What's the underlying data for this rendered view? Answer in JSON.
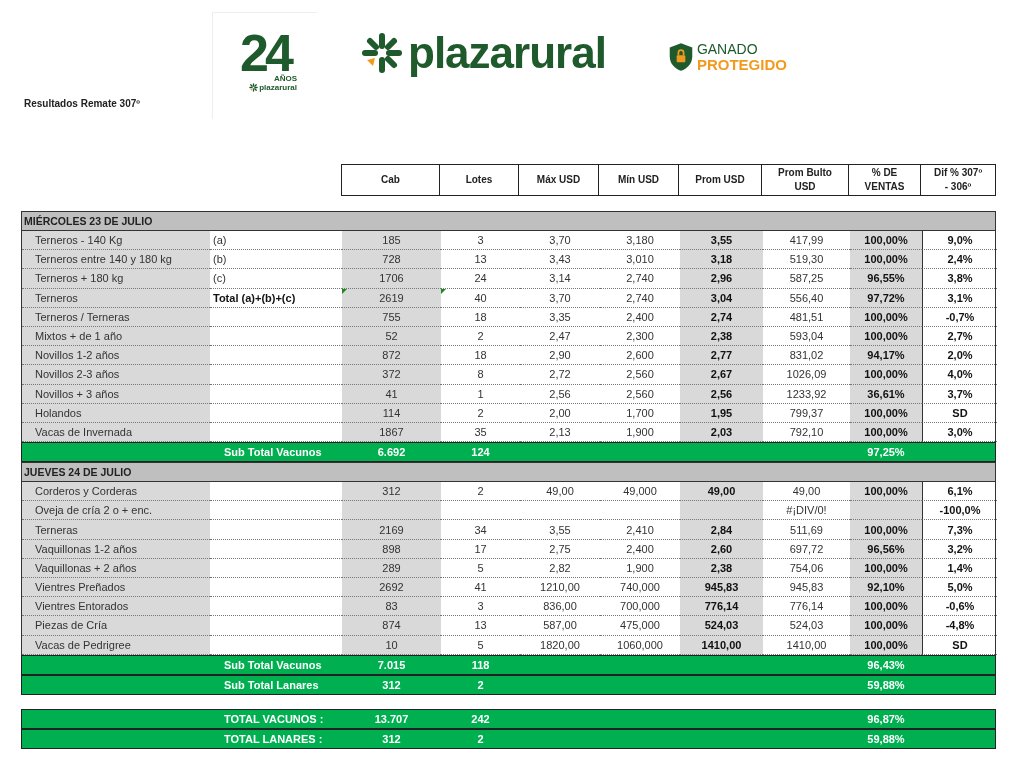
{
  "page_title": "Resultados Remate 307º",
  "anniversary_logo": {
    "number": "24",
    "label": "AÑOS",
    "brand": "plazarural"
  },
  "brand_logo": {
    "name": "plazarural"
  },
  "badge_logo": {
    "line_1": "GANADO",
    "line_2": "PROTEGIDO"
  },
  "columns": [
    "Cab",
    "Lotes",
    "Máx USD",
    "Mín USD",
    "Prom USD",
    "Prom Bulto USD",
    "% DE VENTAS",
    "Dif % 307º - 306º"
  ],
  "sections": [
    {
      "title": "MIÉRCOLES 23 DE JULIO",
      "rows": [
        {
          "kind": "item",
          "name": "Terneros - 140 Kg",
          "note": "(a)",
          "cab": "185",
          "lotes": "3",
          "max": "3,70",
          "min": "3,180",
          "prom": "3,55",
          "bulto": "417,99",
          "pct": "100,00%",
          "dif": "9,0%"
        },
        {
          "kind": "item",
          "name": "Terneros entre 140 y 180 kg",
          "note": "(b)",
          "cab": "728",
          "lotes": "13",
          "max": "3,43",
          "min": "3,010",
          "prom": "3,18",
          "bulto": "519,30",
          "pct": "100,00%",
          "dif": "2,4%"
        },
        {
          "kind": "item",
          "name": "Terneros + 180 kg",
          "note": "(c)",
          "cab": "1706",
          "lotes": "24",
          "max": "3,14",
          "min": "2,740",
          "prom": "2,96",
          "bulto": "587,25",
          "pct": "96,55%",
          "dif": "3,8%"
        },
        {
          "kind": "total",
          "name": "Terneros",
          "note": "Total (a)+(b)+(c)",
          "cab": "2619",
          "lotes": "40",
          "max": "3,70",
          "min": "2,740",
          "prom": "3,04",
          "bulto": "556,40",
          "pct": "97,72%",
          "dif": "3,1%"
        },
        {
          "kind": "item",
          "name": "Terneros / Terneras",
          "cab": "755",
          "lotes": "18",
          "max": "3,35",
          "min": "2,400",
          "prom": "2,74",
          "bulto": "481,51",
          "pct": "100,00%",
          "dif": "-0,7%"
        },
        {
          "kind": "item",
          "name": "Mixtos + de 1 año",
          "cab": "52",
          "lotes": "2",
          "max": "2,47",
          "min": "2,300",
          "prom": "2,38",
          "bulto": "593,04",
          "pct": "100,00%",
          "dif": "2,7%"
        },
        {
          "kind": "item",
          "name": "Novillos 1-2 años",
          "cab": "872",
          "lotes": "18",
          "max": "2,90",
          "min": "2,600",
          "prom": "2,77",
          "bulto": "831,02",
          "pct": "94,17%",
          "dif": "2,0%"
        },
        {
          "kind": "item",
          "name": "Novillos 2-3 años",
          "cab": "372",
          "lotes": "8",
          "max": "2,72",
          "min": "2,560",
          "prom": "2,67",
          "bulto": "1026,09",
          "pct": "100,00%",
          "dif": "4,0%"
        },
        {
          "kind": "item",
          "name": "Novillos + 3 años",
          "cab": "41",
          "lotes": "1",
          "max": "2,56",
          "min": "2,560",
          "prom": "2,56",
          "bulto": "1233,92",
          "pct": "36,61%",
          "dif": "3,7%"
        },
        {
          "kind": "item",
          "name": "Holandos",
          "cab": "114",
          "lotes": "2",
          "max": "2,00",
          "min": "1,700",
          "prom": "1,95",
          "bulto": "799,37",
          "pct": "100,00%",
          "dif": "SD"
        },
        {
          "kind": "item",
          "name": "Vacas de Invernada",
          "cab": "1867",
          "lotes": "35",
          "max": "2,13",
          "min": "1,900",
          "prom": "2,03",
          "bulto": "792,10",
          "pct": "100,00%",
          "dif": "3,0%"
        }
      ],
      "subtotals": [
        {
          "label": "Sub Total Vacunos",
          "cab": "6.692",
          "lotes": "124",
          "pct": "97,25%"
        }
      ]
    },
    {
      "title": "JUEVES 24 DE JULIO",
      "rows": [
        {
          "kind": "item",
          "name": "Corderos y Corderas",
          "cab": "312",
          "lotes": "2",
          "max": "49,00",
          "min": "49,000",
          "prom": "49,00",
          "bulto": "49,00",
          "pct": "100,00%",
          "dif": "6,1%"
        },
        {
          "kind": "item",
          "name": "Oveja de cría 2 o + enc.",
          "bulto": "#¡DIV/0!",
          "dif": "-100,0%"
        },
        {
          "kind": "item",
          "name": "Terneras",
          "cab": "2169",
          "lotes": "34",
          "max": "3,55",
          "min": "2,410",
          "prom": "2,84",
          "bulto": "511,69",
          "pct": "100,00%",
          "dif": "7,3%"
        },
        {
          "kind": "item",
          "name": "Vaquillonas 1-2 años",
          "cab": "898",
          "lotes": "17",
          "max": "2,75",
          "min": "2,400",
          "prom": "2,60",
          "bulto": "697,72",
          "pct": "96,56%",
          "dif": "3,2%"
        },
        {
          "kind": "item",
          "name": "Vaquillonas + 2 años",
          "cab": "289",
          "lotes": "5",
          "max": "2,82",
          "min": "1,900",
          "prom": "2,38",
          "bulto": "754,06",
          "pct": "100,00%",
          "dif": "1,4%"
        },
        {
          "kind": "item",
          "name": "Vientres Preñados",
          "cab": "2692",
          "lotes": "41",
          "max": "1210,00",
          "min": "740,000",
          "prom": "945,83",
          "bulto": "945,83",
          "pct": "92,10%",
          "dif": "5,0%"
        },
        {
          "kind": "item",
          "name": "Vientres Entorados",
          "cab": "83",
          "lotes": "3",
          "max": "836,00",
          "min": "700,000",
          "prom": "776,14",
          "bulto": "776,14",
          "pct": "100,00%",
          "dif": "-0,6%"
        },
        {
          "kind": "item",
          "name": "Piezas de Cría",
          "cab": "874",
          "lotes": "13",
          "max": "587,00",
          "min": "475,000",
          "prom": "524,03",
          "bulto": "524,03",
          "pct": "100,00%",
          "dif": "-4,8%"
        },
        {
          "kind": "item",
          "name": "Vacas de Pedrigree",
          "cab": "10",
          "lotes": "5",
          "max": "1820,00",
          "min": "1060,000",
          "prom": "1410,00",
          "bulto": "1410,00",
          "pct": "100,00%",
          "dif": "SD"
        }
      ],
      "subtotals": [
        {
          "label": "Sub Total Vacunos",
          "cab": "7.015",
          "lotes": "118",
          "pct": "96,43%"
        },
        {
          "label": "Sub Total Lanares",
          "cab": "312",
          "lotes": "2",
          "pct": "59,88%"
        }
      ]
    }
  ],
  "totals": [
    {
      "label": "TOTAL VACUNOS :",
      "cab": "13.707",
      "lotes": "242",
      "pct": "96,87%"
    },
    {
      "label": "TOTAL LANARES :",
      "cab": "312",
      "lotes": "2",
      "pct": "59,88%"
    }
  ]
}
